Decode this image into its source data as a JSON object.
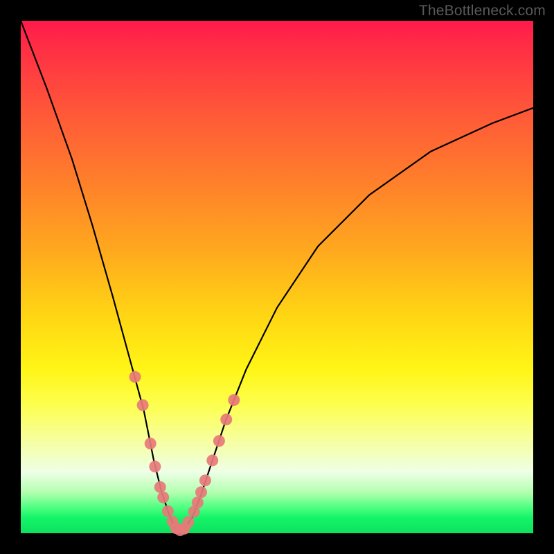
{
  "watermark": "TheBottleneck.com",
  "colors": {
    "curve_stroke": "#000000",
    "marker_fill": "#e77a7a",
    "marker_stroke": "#e77a7a"
  },
  "chart_data": {
    "type": "line",
    "title": "",
    "xlabel": "",
    "ylabel": "",
    "xlim": [
      0,
      100
    ],
    "ylim": [
      0,
      100
    ],
    "series": [
      {
        "name": "bottleneck-curve",
        "x": [
          0,
          5,
          10,
          14,
          18,
          21,
          24,
          26,
          27.5,
          29,
          30,
          31,
          32,
          33.5,
          35,
          37,
          40,
          44,
          50,
          58,
          68,
          80,
          92,
          100
        ],
        "y": [
          100,
          87,
          73,
          60,
          46,
          35,
          24,
          14,
          8,
          3.5,
          1.2,
          0.5,
          1.0,
          3.2,
          7,
          13,
          22,
          32,
          44,
          56,
          66,
          74.5,
          80,
          83
        ]
      }
    ],
    "markers": {
      "name": "highlighted-points",
      "x": [
        22.3,
        23.8,
        25.3,
        26.2,
        27.2,
        27.8,
        28.7,
        29.6,
        30.3,
        31.1,
        31.9,
        32.7,
        33.8,
        34.5,
        35.2,
        36.0,
        37.4,
        38.7,
        40.1,
        41.6
      ],
      "y": [
        30.5,
        25.0,
        17.5,
        13.0,
        9.0,
        7.0,
        4.3,
        2.3,
        1.0,
        0.6,
        0.9,
        2.2,
        4.2,
        6.0,
        8.0,
        10.3,
        14.2,
        18.0,
        22.2,
        26.0
      ]
    }
  }
}
